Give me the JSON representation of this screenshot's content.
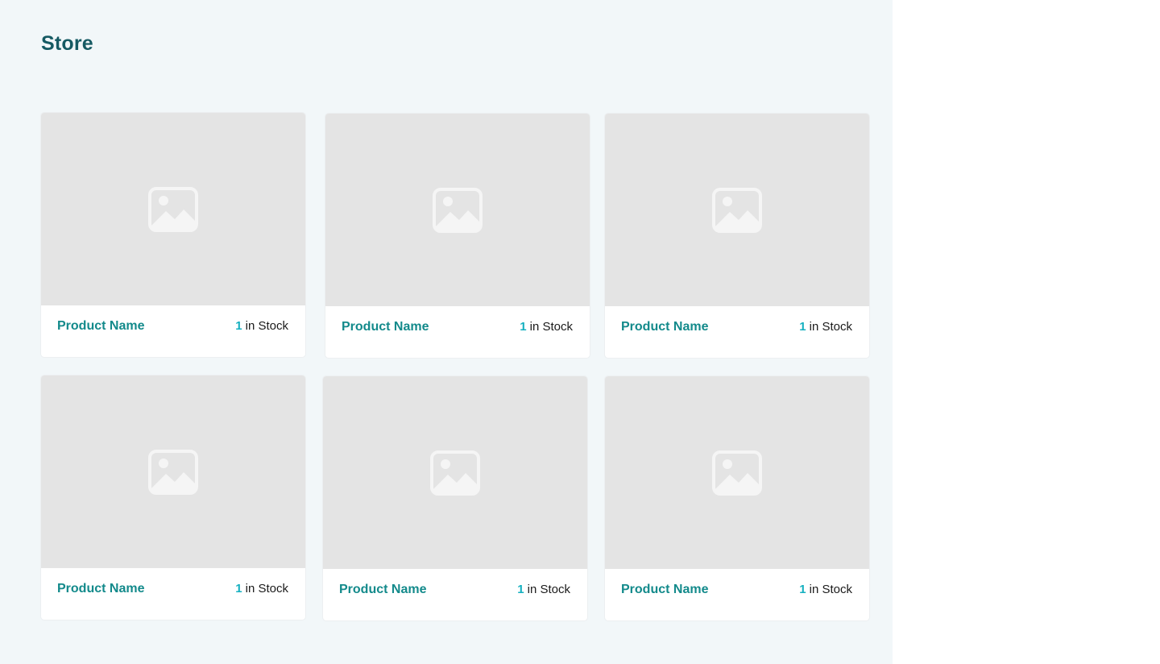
{
  "page": {
    "title": "Store"
  },
  "products": [
    {
      "name": "Product Name",
      "stock_count": "1",
      "stock_label": "in Stock",
      "image_icon": "image-placeholder-icon"
    },
    {
      "name": "Product Name",
      "stock_count": "1",
      "stock_label": "in Stock",
      "image_icon": "image-placeholder-icon"
    },
    {
      "name": "Product Name",
      "stock_count": "1",
      "stock_label": "in Stock",
      "image_icon": "image-placeholder-icon"
    },
    {
      "name": "Product Name",
      "stock_count": "1",
      "stock_label": "in Stock",
      "image_icon": "image-placeholder-icon"
    },
    {
      "name": "Product Name",
      "stock_count": "1",
      "stock_label": "in Stock",
      "image_icon": "image-placeholder-icon"
    },
    {
      "name": "Product Name",
      "stock_count": "1",
      "stock_label": "in Stock",
      "image_icon": "image-placeholder-icon"
    }
  ],
  "colors": {
    "panel_background": "#f2f7f9",
    "title": "#165a63",
    "product_name": "#138a8b",
    "stock_count": "#15b0c0",
    "image_placeholder": "#e4e4e4"
  }
}
